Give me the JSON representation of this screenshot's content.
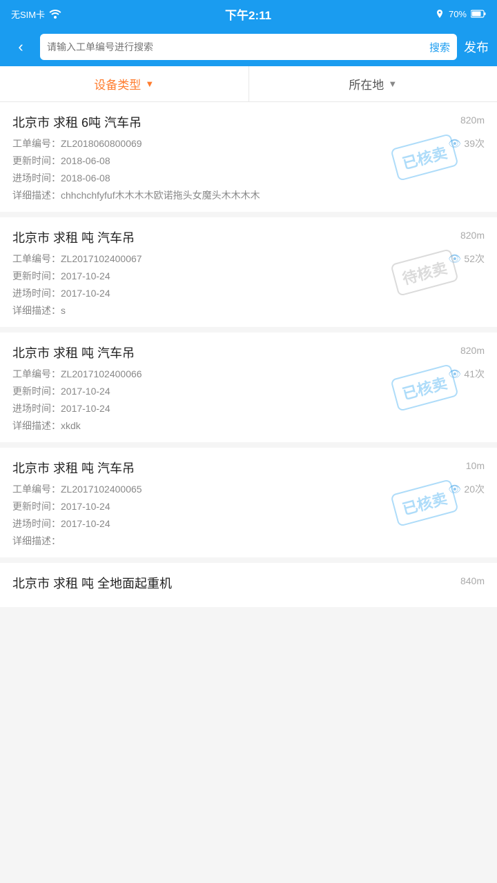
{
  "statusBar": {
    "left": "无SIM卡 ☁",
    "time": "下午2:11",
    "battery": "70%"
  },
  "navBar": {
    "backIcon": "‹",
    "searchPlaceholder": "请输入工单编号进行搜索",
    "searchLabel": "搜索",
    "publishLabel": "发布"
  },
  "filterBar": {
    "deviceTypeLabel": "设备类型",
    "locationLabel": "所在地"
  },
  "items": [
    {
      "title": "北京市 求租 6吨 汽车吊",
      "distance": "820m",
      "orderNo": "工单编号：ZL2018060800069",
      "views": "39次",
      "updateTime": "更新时间：2018-06-08",
      "entryTime": "进场时间：2018-06-08",
      "description": "详细描述：chhchchfyfuf木木木木欧诺拖头女魔头木木木木",
      "stamp": "已核卖",
      "stampType": "sold"
    },
    {
      "title": "北京市 求租 吨 汽车吊",
      "distance": "820m",
      "orderNo": "工单编号：ZL2017102400067",
      "views": "52次",
      "updateTime": "更新时间：2017-10-24",
      "entryTime": "进场时间：2017-10-24",
      "description": "详细描述：s",
      "stamp": "待核卖",
      "stampType": "pending"
    },
    {
      "title": "北京市 求租 吨 汽车吊",
      "distance": "820m",
      "orderNo": "工单编号：ZL2017102400066",
      "views": "41次",
      "updateTime": "更新时间：2017-10-24",
      "entryTime": "进场时间：2017-10-24",
      "description": "详细描述：xkdk",
      "stamp": "已核卖",
      "stampType": "sold"
    },
    {
      "title": "北京市 求租 吨 汽车吊",
      "distance": "10m",
      "orderNo": "工单编号：ZL2017102400065",
      "views": "20次",
      "updateTime": "更新时间：2017-10-24",
      "entryTime": "进场时间：2017-10-24",
      "description": "详细描述：",
      "stamp": "已核卖",
      "stampType": "sold"
    },
    {
      "title": "北京市 求租 吨 全地面起重机",
      "distance": "840m",
      "orderNo": "",
      "views": "",
      "updateTime": "",
      "entryTime": "",
      "description": "",
      "stamp": "",
      "stampType": ""
    }
  ]
}
